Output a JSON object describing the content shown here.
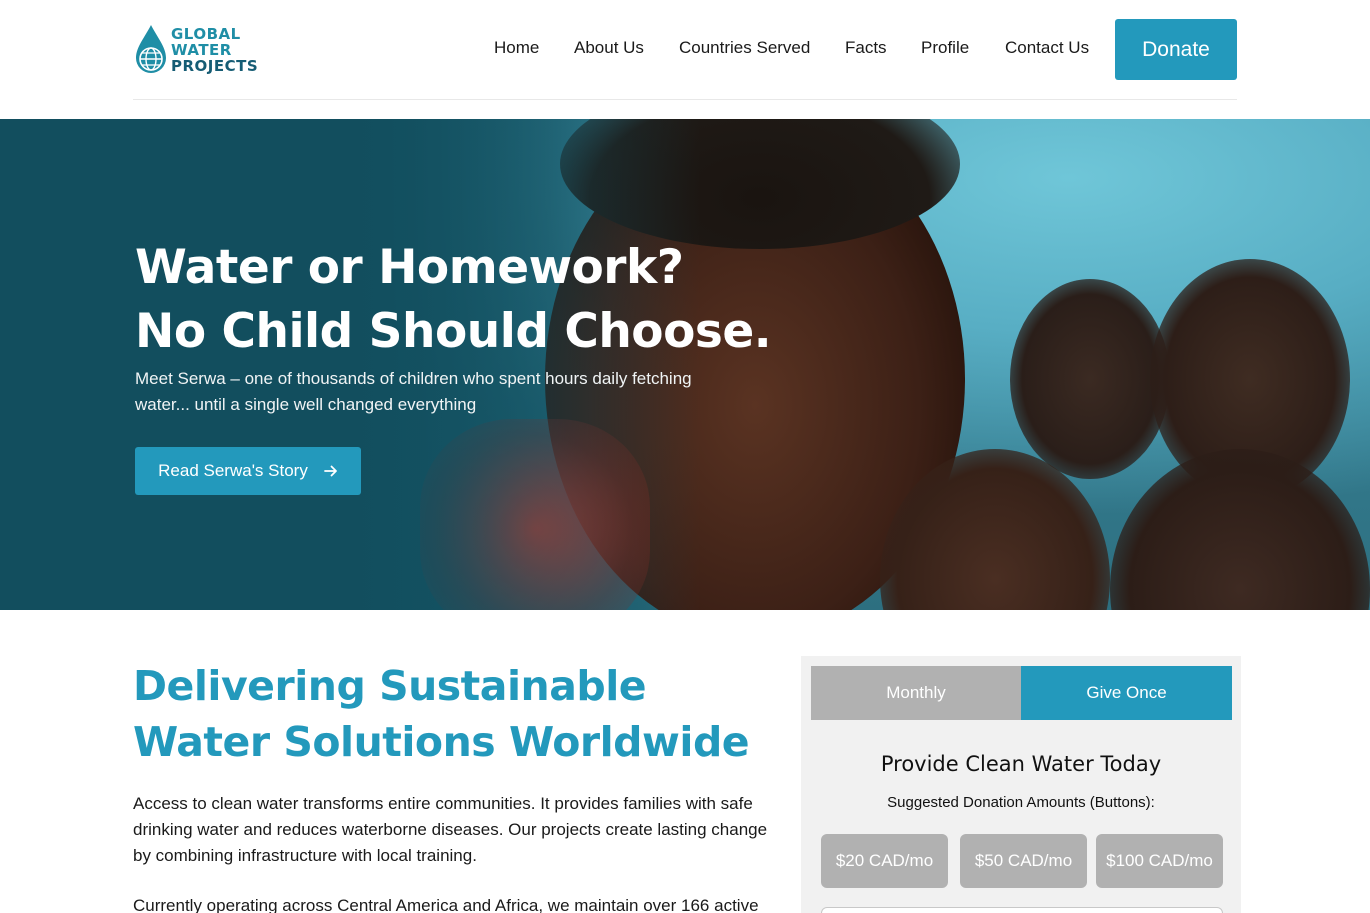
{
  "header": {
    "logo": {
      "line1": "GLOBAL",
      "line2": "WATER",
      "line3": "PROJECTS",
      "icon": "water-drop-globe-icon"
    },
    "nav": [
      {
        "label": "Home"
      },
      {
        "label": "About Us"
      },
      {
        "label": "Countries Served"
      },
      {
        "label": "Facts"
      },
      {
        "label": "Profile"
      },
      {
        "label": "Contact Us"
      }
    ],
    "donate_label": "Donate"
  },
  "hero": {
    "title_line1": "Water or Homework?",
    "title_line2": "No Child Should Choose.",
    "subtitle": "Meet Serwa – one of thousands of children who spent hours daily fetching water... until a single well changed everything",
    "cta_label": "Read Serwa's Story",
    "cta_icon": "arrow-right-icon"
  },
  "main": {
    "title": "Delivering Sustainable Water Solutions Worldwide",
    "paragraph1": "Access to clean water transforms entire communities. It provides families with safe drinking water and reduces waterborne diseases. Our projects create lasting change by combining infrastructure with local training.",
    "paragraph2": "Currently operating across Central America and Africa, we maintain over 166 active"
  },
  "donation": {
    "tabs": [
      {
        "label": "Monthly",
        "active": false
      },
      {
        "label": "Give Once",
        "active": true
      }
    ],
    "title": "Provide Clean Water Today",
    "subtitle": "Suggested Donation Amounts (Buttons):",
    "amounts": [
      {
        "label": "$20 CAD/mo"
      },
      {
        "label": "$50 CAD/mo"
      },
      {
        "label": "$100 CAD/mo"
      }
    ]
  },
  "colors": {
    "accent": "#2399bc",
    "hero_dark": "#124e5e",
    "inactive_tab": "#b1b1b1"
  }
}
